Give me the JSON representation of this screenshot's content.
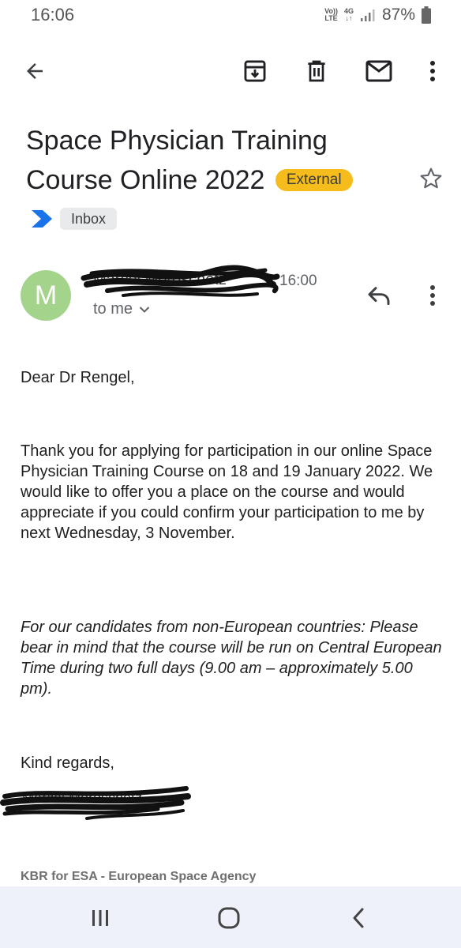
{
  "status_bar": {
    "time": "16:06",
    "volte": [
      "Vo))",
      "LTE"
    ],
    "network": [
      "4G",
      "↓↑"
    ],
    "battery": "87%"
  },
  "toolbar": {
    "back_icon": "arrow-left-icon",
    "archive_icon": "archive-icon",
    "delete_icon": "trash-icon",
    "mark_unread_icon": "mail-icon",
    "more_icon": "more-vert-icon"
  },
  "email": {
    "subject_line1": "Space Physician Training",
    "subject_line2": "Course Online 2022",
    "external_badge": "External",
    "label": "Inbox",
    "sender_initial": "M",
    "sender_name": "Marcel Moroschetz",
    "time": "16:00",
    "recipient": "to me",
    "greeting": "Dear Dr Rengel,",
    "paragraph_main": "Thank you for applying for participation in our online Space Physician Training Course on 18 and 19 January 2022. We would like to offer you a place on the course and would appreciate if you could confirm your participation to me by next Wednesday, 3 November.",
    "paragraph_italic": "For our candidates from non-European countries: Please bear in mind that the course will be run on Central European Time during two full days (9.00 am – approximately 5.00 pm).",
    "closing": "Kind regards,",
    "signature_name": "Marcel Moroschetz",
    "company": "KBR for ESA - European Space Agency"
  },
  "colors": {
    "external_badge": "#f6bc1c",
    "avatar": "#a4d48c",
    "label_arrow": "#1a73e8",
    "nav_bar": "#eef1fa"
  },
  "nav_bar": {
    "recents_icon": "recents-icon",
    "home_icon": "home-icon",
    "back_icon": "nav-back-icon"
  }
}
